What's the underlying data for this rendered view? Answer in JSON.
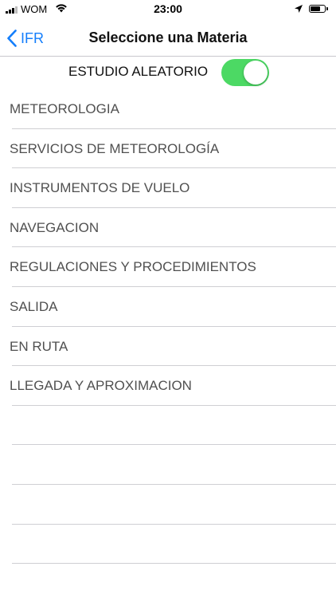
{
  "status_bar": {
    "carrier": "WOM",
    "time": "23:00",
    "signal_icon": "cellular-signal-icon",
    "wifi_icon": "wifi-icon",
    "location_icon": "location-arrow-icon",
    "battery_icon": "battery-icon"
  },
  "nav": {
    "back_label": "IFR",
    "back_icon": "chevron-left-icon",
    "title": "Seleccione una Materia"
  },
  "random_study": {
    "label": "ESTUDIO ALEATORIO",
    "enabled": true,
    "on_color": "#4cd964"
  },
  "subjects": [
    "METEOROLOGIA",
    "SERVICIOS DE METEOROLOGÍA",
    "INSTRUMENTOS DE VUELO",
    "NAVEGACION",
    "REGULACIONES Y PROCEDIMIENTOS",
    "SALIDA",
    "EN RUTA",
    "LLEGADA Y APROXIMACION"
  ],
  "colors": {
    "accent": "#147efb",
    "text": "#505050",
    "separator": "#cfcfd3"
  }
}
